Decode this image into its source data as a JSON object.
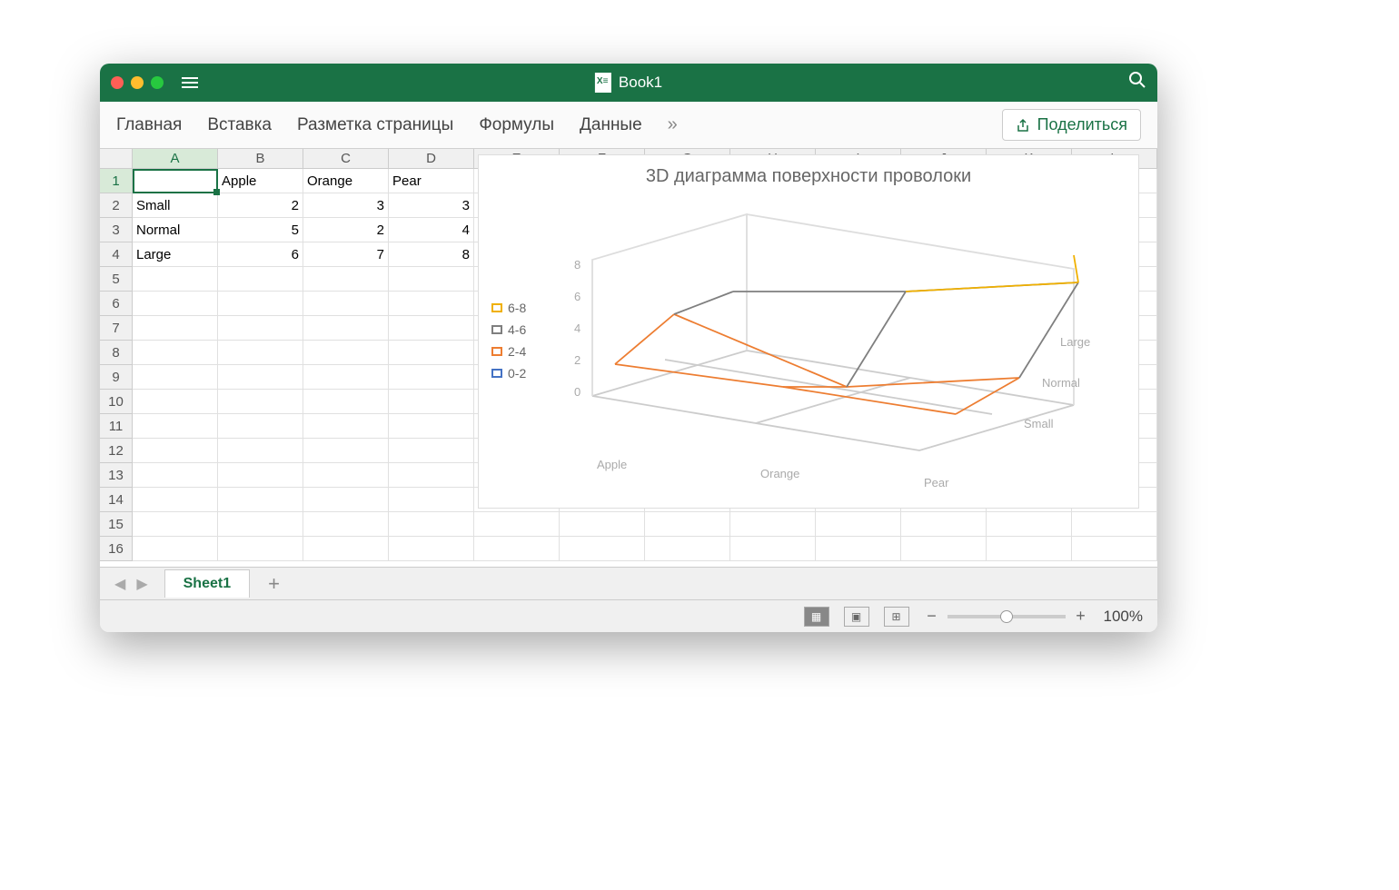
{
  "titlebar": {
    "title": "Book1"
  },
  "ribbon": {
    "tabs": [
      "Главная",
      "Вставка",
      "Разметка страницы",
      "Формулы",
      "Данные"
    ],
    "more": "»",
    "share": "Поделиться"
  },
  "columns": [
    "A",
    "B",
    "C",
    "D",
    "E",
    "F",
    "G",
    "H",
    "I",
    "J",
    "K",
    "L"
  ],
  "row_numbers": [
    1,
    2,
    3,
    4,
    5,
    6,
    7,
    8,
    9,
    10,
    11,
    12,
    13,
    14,
    15,
    16
  ],
  "active_cell": "A1",
  "cells": {
    "B1": "Apple",
    "C1": "Orange",
    "D1": "Pear",
    "A2": "Small",
    "B2": "2",
    "C2": "3",
    "D2": "3",
    "A3": "Normal",
    "B3": "5",
    "C3": "2",
    "D3": "4",
    "A4": "Large",
    "B4": "6",
    "C4": "7",
    "D4": "8"
  },
  "chart_data": {
    "type": "surface-wireframe-3d",
    "title": "3D диаграмма поверхности проволоки",
    "x_categories": [
      "Apple",
      "Orange",
      "Pear"
    ],
    "y_categories": [
      "Small",
      "Normal",
      "Large"
    ],
    "z_axis_ticks": [
      0,
      2,
      4,
      6,
      8
    ],
    "values": [
      [
        2,
        3,
        3
      ],
      [
        5,
        2,
        4
      ],
      [
        6,
        7,
        8
      ]
    ],
    "legend": [
      {
        "label": "6-8",
        "color": "#f0b000"
      },
      {
        "label": "4-6",
        "color": "#7f7f7f"
      },
      {
        "label": "2-4",
        "color": "#ed7d31"
      },
      {
        "label": "0-2",
        "color": "#4472c4"
      }
    ]
  },
  "sheet": {
    "active": "Sheet1"
  },
  "status": {
    "zoom": "100%"
  }
}
